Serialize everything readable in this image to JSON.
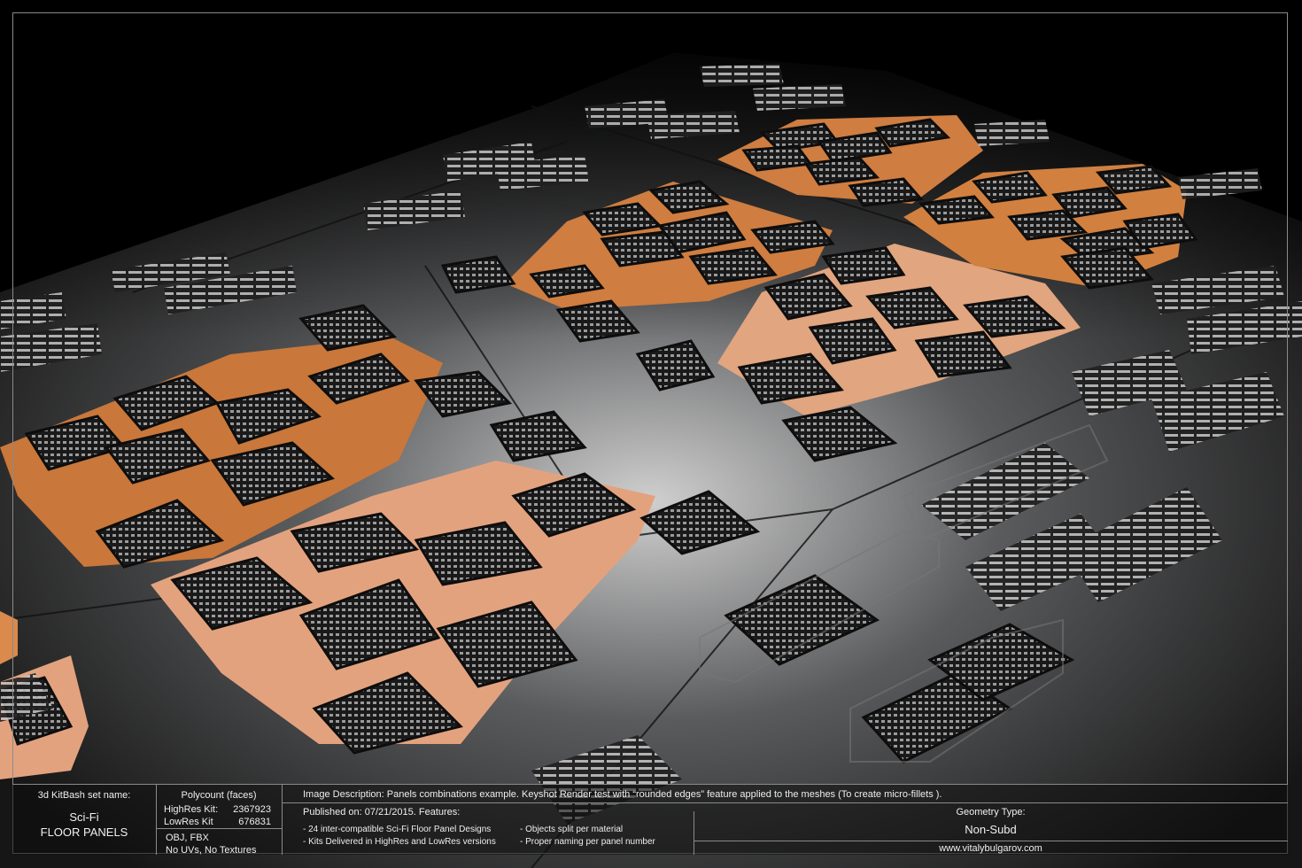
{
  "kit": {
    "set_name_label": "3d KitBash set name:",
    "name_line1": "Sci-Fi",
    "name_line2": "FLOOR PANELS"
  },
  "polycount": {
    "title": "Polycount (faces)",
    "highres_label": "HighRes Kit:",
    "highres_value": "2367923",
    "lowres_label": "LowRes Kit",
    "lowres_value": "676831",
    "formats": "OBJ, FBX",
    "uv_note": "No UVs, No Textures"
  },
  "description": {
    "text": "Image Description: Panels combinations example. Keyshot Render test with “rounded edges” feature applied to the meshes (To create micro-fillets ).",
    "published": "Published on: 07/21/2015. Features:",
    "features": [
      "-   24 inter-compatible Sci-Fi Floor Panel Designs",
      "-   Kits Delivered in HighRes and LowRes versions",
      "-   Objects split per material",
      "-   Proper naming per panel number"
    ]
  },
  "geometry": {
    "label": "Geometry Type:",
    "value": "Non-Subd",
    "website": "www.vitalybulgarov.com"
  },
  "colors": {
    "copper": "#c9773a",
    "metal": "#2a2b2d",
    "background": "#000000"
  }
}
